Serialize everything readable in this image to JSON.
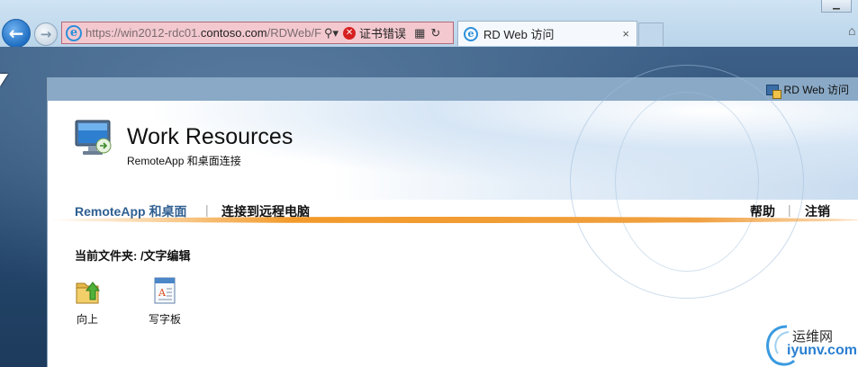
{
  "browser": {
    "address": {
      "url_prefix": "https://win2012-rdc01.",
      "url_domain": "contoso.com",
      "url_suffix": "/RDWeb/F",
      "cert_error": "证书错误"
    },
    "tab": {
      "title": "RD Web 访问",
      "close": "×"
    }
  },
  "rdweb": {
    "top_link": "RD Web 访问",
    "title": "Work Resources",
    "subtitle": "RemoteApp 和桌面连接",
    "nav": {
      "remoteapp": "RemoteApp 和桌面",
      "sep": "|",
      "connect": "连接到远程电脑",
      "help": "帮助",
      "logout": "注销"
    },
    "current_folder": "当前文件夹: /文字编辑",
    "items": [
      {
        "label": "向上",
        "icon": "folder-up-icon"
      },
      {
        "label": "写字板",
        "icon": "wordpad-icon"
      }
    ]
  },
  "watermark": {
    "line1": "运维网",
    "line2": "iyunv.com"
  }
}
